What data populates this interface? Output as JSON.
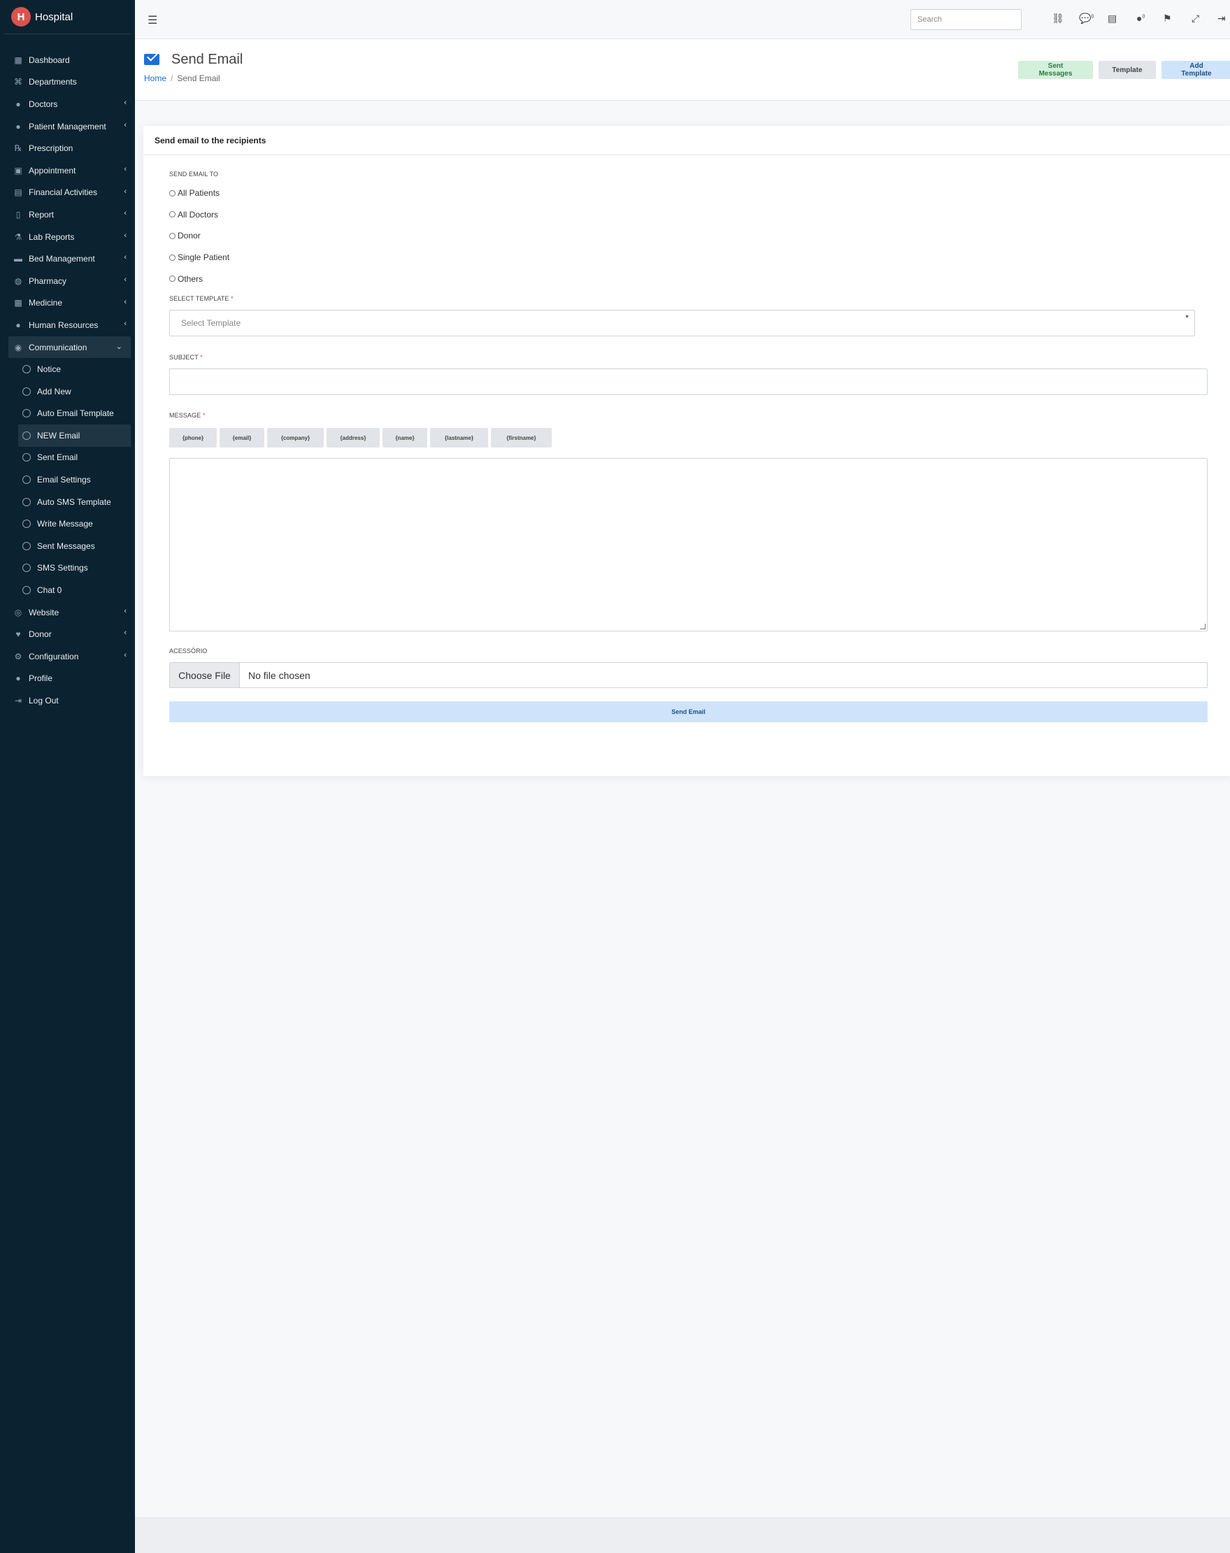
{
  "app": {
    "brand": "Hospital",
    "logo_letter": "H"
  },
  "sidebar": {
    "items": [
      {
        "label": "Dashboard",
        "icon": "grid-icon",
        "glyph": "▦",
        "chevron": false
      },
      {
        "label": "Departments",
        "icon": "sitemap-icon",
        "glyph": "⌘",
        "chevron": false
      },
      {
        "label": "Doctors",
        "icon": "user-md-icon",
        "glyph": "●",
        "chevron": true
      },
      {
        "label": "Patient Management",
        "icon": "user-icon",
        "glyph": "●",
        "chevron": true
      },
      {
        "label": "Prescription",
        "icon": "prescription-icon",
        "glyph": "℞",
        "chevron": false
      },
      {
        "label": "Appointment",
        "icon": "calendar-check-icon",
        "glyph": "▣",
        "chevron": true
      },
      {
        "label": "Financial Activities",
        "icon": "money-check-icon",
        "glyph": "▤",
        "chevron": true
      },
      {
        "label": "Report",
        "icon": "file-icon",
        "glyph": "▯",
        "chevron": true
      },
      {
        "label": "Lab Reports",
        "icon": "flask-icon",
        "glyph": "⚗",
        "chevron": true
      },
      {
        "label": "Bed Management",
        "icon": "bed-icon",
        "glyph": "▬",
        "chevron": true
      },
      {
        "label": "Pharmacy",
        "icon": "pills-icon",
        "glyph": "◍",
        "chevron": true
      },
      {
        "label": "Medicine",
        "icon": "medkit-icon",
        "glyph": "▩",
        "chevron": true
      },
      {
        "label": "Human Resources",
        "icon": "users-icon",
        "glyph": "●",
        "chevron": true
      },
      {
        "label": "Communication",
        "icon": "comments-icon",
        "glyph": "◉",
        "chevron": true,
        "open": true
      }
    ],
    "communication_sub": [
      {
        "label": "Notice"
      },
      {
        "label": "Add New"
      },
      {
        "label": "Auto Email Template"
      },
      {
        "label": "NEW Email",
        "active": true
      },
      {
        "label": "Sent Email"
      },
      {
        "label": "Email Settings"
      },
      {
        "label": "Auto SMS Template"
      },
      {
        "label": "Write Message"
      },
      {
        "label": "Sent Messages"
      },
      {
        "label": "SMS Settings"
      },
      {
        "label": "Chat 0"
      }
    ],
    "items_after": [
      {
        "label": "Website",
        "icon": "globe-icon",
        "glyph": "◎",
        "chevron": true
      },
      {
        "label": "Donor",
        "icon": "hand-holding-heart-icon",
        "glyph": "♥",
        "chevron": true
      },
      {
        "label": "Configuration",
        "icon": "gear-icon",
        "glyph": "⚙",
        "chevron": true
      },
      {
        "label": "Profile",
        "icon": "user-icon",
        "glyph": "●",
        "chevron": false
      },
      {
        "label": "Log Out",
        "icon": "logout-icon",
        "glyph": "⇥",
        "chevron": false
      }
    ]
  },
  "topbar": {
    "search_placeholder": "Search",
    "icons": [
      {
        "name": "link-icon",
        "glyph": "⛓"
      },
      {
        "name": "comments-icon",
        "glyph": "💬",
        "badge": "0"
      },
      {
        "name": "payment-icon",
        "glyph": "▤"
      },
      {
        "name": "user-badge-icon",
        "glyph": "●",
        "badge": "0"
      },
      {
        "name": "us-flag-icon",
        "glyph": "⚑"
      },
      {
        "name": "expand-icon",
        "glyph": "⤢"
      },
      {
        "name": "sign-out-icon",
        "glyph": "⇥"
      }
    ]
  },
  "header": {
    "title": "Send Email",
    "breadcrumb_home": "Home",
    "breadcrumb_current": "Send Email",
    "btn_sent_messages": "Sent Messages",
    "btn_template": "Template",
    "btn_add_template": "Add Template"
  },
  "card": {
    "title": "Send email to the recipients",
    "send_to_label": "SEND EMAIL TO",
    "recipients": [
      "All Patients",
      "All Doctors",
      "Donor",
      "Single Patient",
      "Others"
    ],
    "template_label": "SELECT TEMPLATE",
    "template_placeholder": "Select Template",
    "subject_label": "SUBJECT",
    "message_label": "MESSAGE",
    "tags": [
      "{phone}",
      "{email}",
      "{company}",
      "{address}",
      "{name}",
      "{lastname}",
      "{firstname}"
    ],
    "attachment_label": "ACESSÓRIO",
    "file_button": "Choose File",
    "file_status": "No file chosen",
    "send_button": "Send Email",
    "required_mark": "*"
  },
  "colors": {
    "sidebar_bg": "#0b2230",
    "accent": "#1a6fd6",
    "sent_messages_btn": "#d4f0dc",
    "add_template_btn": "#cfe4fb"
  }
}
